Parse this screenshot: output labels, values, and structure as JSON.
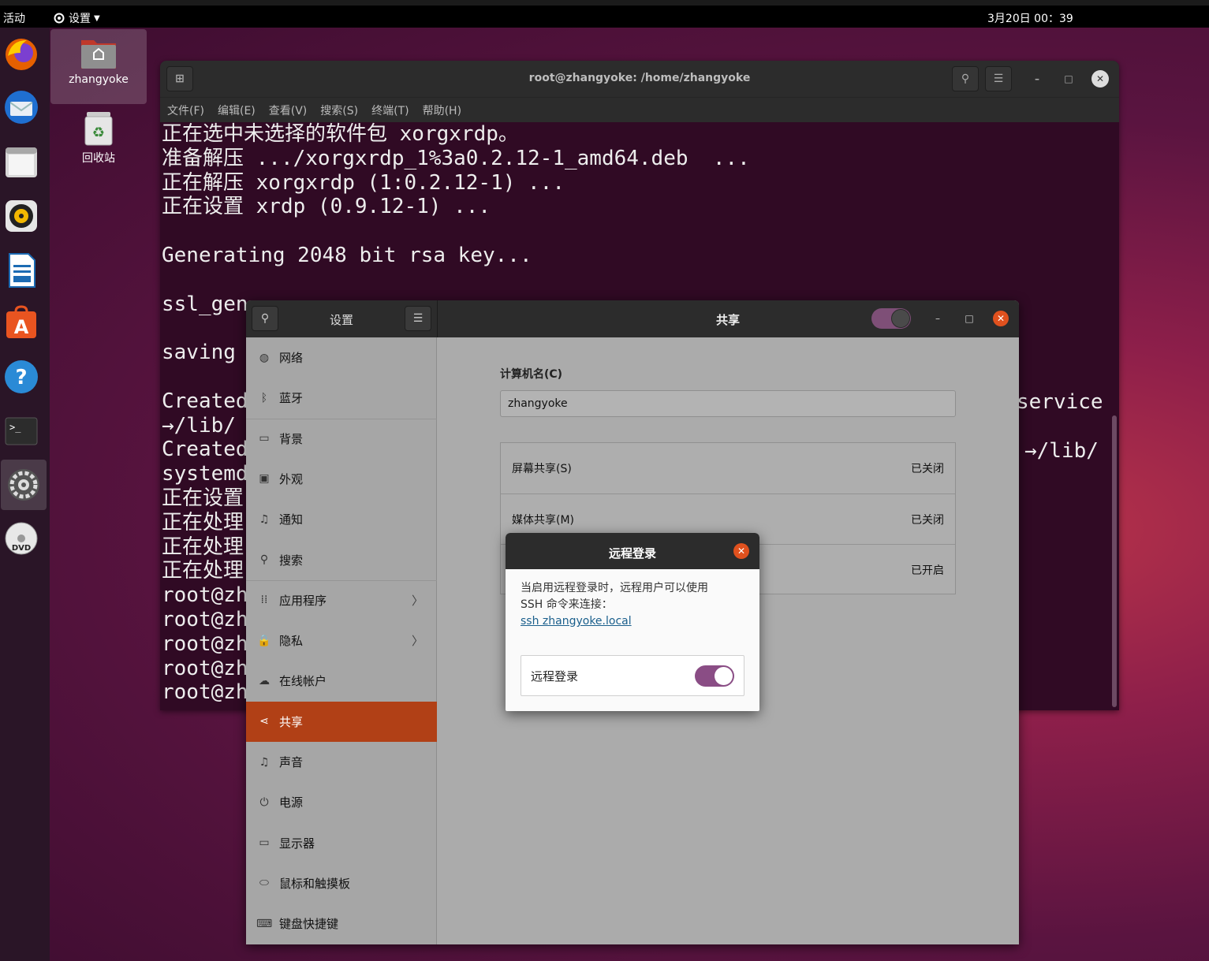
{
  "topbar": {
    "activities": "活动",
    "app_menu": "设置",
    "clock": "3月20日  00：39"
  },
  "desktop": {
    "home_label": "zhangyoke",
    "trash_label": "回收站"
  },
  "dock": {
    "items": [
      "firefox-icon",
      "thunderbird-icon",
      "files-icon",
      "rhythmbox-icon",
      "writer-icon",
      "software-icon",
      "help-icon",
      "terminal-icon",
      "settings-icon",
      "dvd-icon"
    ]
  },
  "terminal": {
    "title": "root@zhangyoke: /home/zhangyoke",
    "menu": [
      "文件(F)",
      "编辑(E)",
      "查看(V)",
      "搜索(S)",
      "终端(T)",
      "帮助(H)"
    ],
    "lines": [
      "正在选中未选择的软件包 xorgxrdp。",
      "准备解压 .../xorgxrdp_1%3a0.2.12-1_amd64.deb  ...",
      "正在解压 xorgxrdp (1:0.2.12-1) ...",
      "正在设置 xrdp (0.9.12-1) ...",
      "",
      "Generating 2048 bit rsa key...",
      "",
      "ssl_gen",
      "",
      "saving",
      "",
      "Created",
      "→/lib/",
      "Created",
      "systemd",
      "正在设置",
      "正在处理",
      "正在处理",
      "正在处理",
      "root@zh",
      "root@zh",
      "root@zh",
      "root@zh",
      "root@zh"
    ],
    "right_line1": "service",
    "right_line2": "→/lib/"
  },
  "settings": {
    "sidebar_title": "设置",
    "panel_title": "共享",
    "sidebar": [
      {
        "label": "网络",
        "icon": "network-icon",
        "glyph": "◍"
      },
      {
        "label": "蓝牙",
        "icon": "bluetooth-icon",
        "glyph": "ᛒ"
      },
      {
        "label": "背景",
        "icon": "background-icon",
        "glyph": "▭"
      },
      {
        "label": "外观",
        "icon": "appearance-icon",
        "glyph": "▣"
      },
      {
        "label": "通知",
        "icon": "notification-icon",
        "glyph": "♫"
      },
      {
        "label": "搜索",
        "icon": "search-icon",
        "glyph": "⚲"
      },
      {
        "label": "应用程序",
        "icon": "apps-icon",
        "glyph": "⁞⁞"
      },
      {
        "label": "隐私",
        "icon": "lock-icon",
        "glyph": "🔒"
      },
      {
        "label": "在线帐户",
        "icon": "cloud-icon",
        "glyph": "☁"
      },
      {
        "label": "共享",
        "icon": "share-icon",
        "glyph": "⋖"
      },
      {
        "label": "声音",
        "icon": "music-note-icon",
        "glyph": "♫"
      },
      {
        "label": "电源",
        "icon": "power-icon",
        "glyph": "⏻"
      },
      {
        "label": "显示器",
        "icon": "display-icon",
        "glyph": "▭"
      },
      {
        "label": "鼠标和触摸板",
        "icon": "mouse-icon",
        "glyph": "⬭"
      },
      {
        "label": "键盘快捷键",
        "icon": "keyboard-icon",
        "glyph": "⌨"
      }
    ],
    "hostname_label": "计算机名(C)",
    "hostname_value": "zhangyoke",
    "shares": [
      {
        "label": "屏幕共享(S)",
        "status": "已关闭"
      },
      {
        "label": "媒体共享(M)",
        "status": "已关闭"
      },
      {
        "label": "",
        "status": "已开启"
      }
    ],
    "sharing_switch_on": true
  },
  "dialog": {
    "title": "远程登录",
    "text_line1": "当启用远程登录时，远程用户可以使用",
    "text_line2": "SSH 命令来连接：",
    "link": "ssh zhangyoke.local",
    "toggle_label": "远程登录",
    "toggle_on": true
  },
  "colors": {
    "accent": "#b14016",
    "toggle": "#8a4d85",
    "terminal_bg": "#300a24"
  }
}
